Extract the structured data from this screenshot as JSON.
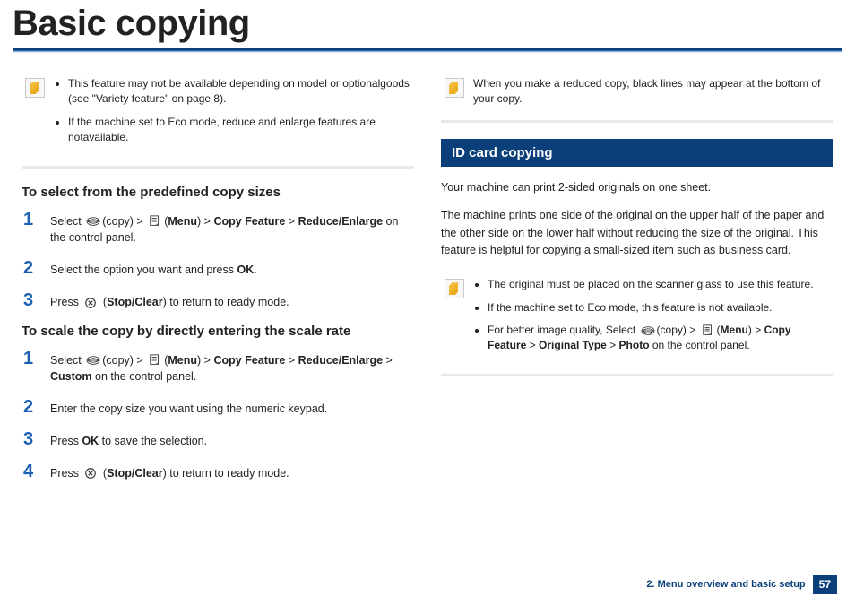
{
  "title": "Basic copying",
  "left": {
    "note1_items": [
      "This feature may not be available depending on model or optionalgoods (see \"Variety feature\" on page 8).",
      "If the machine set to Eco mode, reduce and enlarge features are notavailable."
    ],
    "h1": "To select from the predefined copy sizes",
    "steps1": {
      "s1_pre": "Select ",
      "s1_copy": "(copy) > ",
      "s1_menu_open": "(",
      "s1_menu": "Menu",
      "s1_menu_close": ") > ",
      "s1_cf": "Copy Feature",
      "s1_gt": " > ",
      "s1_re": "Reduce/Enlarge",
      "s1_tail": " on the control panel.",
      "s2_a": "Select the option you want and press ",
      "s2_b": "OK",
      "s2_c": ".",
      "s3_a": "Press ",
      "s3_b": " (",
      "s3_c": "Stop/Clear",
      "s3_d": ") to return to ready mode."
    },
    "h2": "To scale the copy by directly entering the scale rate",
    "steps2": {
      "s1_pre": "Select ",
      "s1_copy": "(copy) > ",
      "s1_menu_open": "(",
      "s1_menu": "Menu",
      "s1_menu_close": ") > ",
      "s1_cf": "Copy Feature",
      "s1_gt1": " > ",
      "s1_re": "Reduce/Enlarge",
      "s1_gt2": " > ",
      "s1_custom": "Custom",
      "s1_tail": " on the control panel.",
      "s2": "Enter the copy size you want using the numeric keypad.",
      "s3_a": "Press ",
      "s3_b": "OK",
      "s3_c": " to save the selection.",
      "s4_a": "Press ",
      "s4_b": " (",
      "s4_c": "Stop/Clear",
      "s4_d": ") to return to ready mode."
    }
  },
  "right": {
    "note_top": "When you make a reduced copy, black lines may appear at the bottom of your copy.",
    "section": "ID card copying",
    "p1": "Your machine can print 2-sided originals on one sheet.",
    "p2": "The machine prints one side of the original on the upper half of the paper and the other side on the lower half without reducing the size of the original. This feature is helpful for copying a small-sized item such as business card.",
    "note2": {
      "li1": "The original must be placed on the scanner glass to use this feature.",
      "li2": "If the machine set to Eco mode, this feature is not available.",
      "li3_a": "For better image quality, Select ",
      "li3_copy": "(copy) > ",
      "li3_menu_open": "(",
      "li3_menu": "Menu",
      "li3_menu_close": ") > ",
      "li3_cf": "Copy Feature",
      "li3_gt1": " > ",
      "li3_ot": "Original Type",
      "li3_gt2": " > ",
      "li3_photo": "Photo",
      "li3_tail": " on the control panel."
    }
  },
  "footer": {
    "chapter": "2. Menu overview and basic setup",
    "page": "57"
  }
}
